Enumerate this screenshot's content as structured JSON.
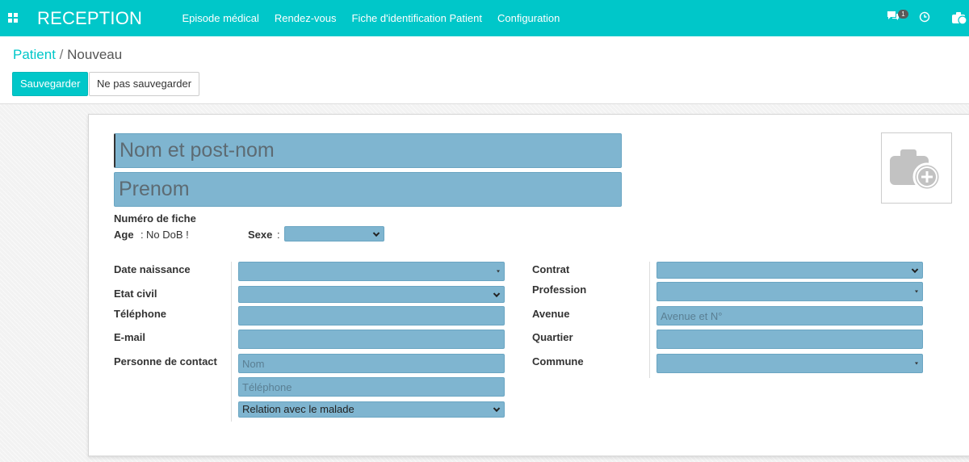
{
  "navbar": {
    "app_title": "RECEPTION",
    "menu": [
      {
        "label": "Episode médical"
      },
      {
        "label": "Rendez-vous"
      },
      {
        "label": "Fiche d'identification Patient"
      },
      {
        "label": "Configuration"
      }
    ],
    "messages_badge": "1",
    "icons": [
      "apps-icon",
      "chat-icon",
      "clock-icon",
      "camera-icon"
    ]
  },
  "breadcrumb": {
    "parent": "Patient",
    "separator": "/",
    "current": "Nouveau"
  },
  "buttons": {
    "save": "Sauvegarder",
    "discard": "Ne pas sauvegarder"
  },
  "form": {
    "name_placeholder": "Nom et post-nom",
    "firstname_placeholder": "Prenom",
    "file_number_label": "Numéro de fiche",
    "age_label": "Age",
    "age_sep": ":",
    "age_value": "No DoB !",
    "sex_label": "Sexe",
    "sex_sep": ":",
    "left": {
      "birth_date": "Date naissance",
      "civil_status": "Etat civil",
      "phone": "Téléphone",
      "email": "E-mail",
      "contact_person": "Personne de contact",
      "contact_name_placeholder": "Nom",
      "contact_phone_placeholder": "Téléphone",
      "contact_relation": "Relation avec le malade"
    },
    "right": {
      "contract": "Contrat",
      "profession": "Profession",
      "avenue": "Avenue",
      "avenue_placeholder": "Avenue et N°",
      "district": "Quartier",
      "commune": "Commune"
    }
  },
  "colors": {
    "accent": "#00c7c9",
    "field_bg": "#7fb5d0"
  }
}
